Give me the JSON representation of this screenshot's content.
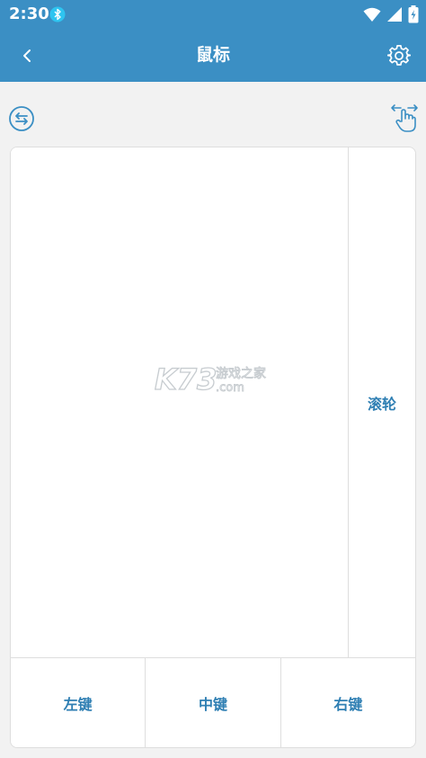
{
  "status_bar": {
    "time": "2:30",
    "icons": [
      "bluetooth-icon",
      "wifi-icon",
      "signal-icon",
      "battery-charging-icon"
    ]
  },
  "app_bar": {
    "title": "鼠标",
    "back_icon": "chevron-left-icon",
    "settings_icon": "gear-icon"
  },
  "toolbar": {
    "switch_icon": "swap-arrows-circle-icon",
    "gesture_icon": "hand-swipe-icon"
  },
  "pad": {
    "scroll_label": "滚轮",
    "buttons": {
      "left": "左键",
      "middle": "中键",
      "right": "右键"
    }
  },
  "watermark": {
    "logo_text": "K73",
    "site_text": "游戏之家",
    "domain_text": ".com"
  },
  "colors": {
    "primary": "#3b8fc4",
    "accent_text": "#2f7fb3",
    "background": "#f2f2f2",
    "divider": "#dedede"
  }
}
